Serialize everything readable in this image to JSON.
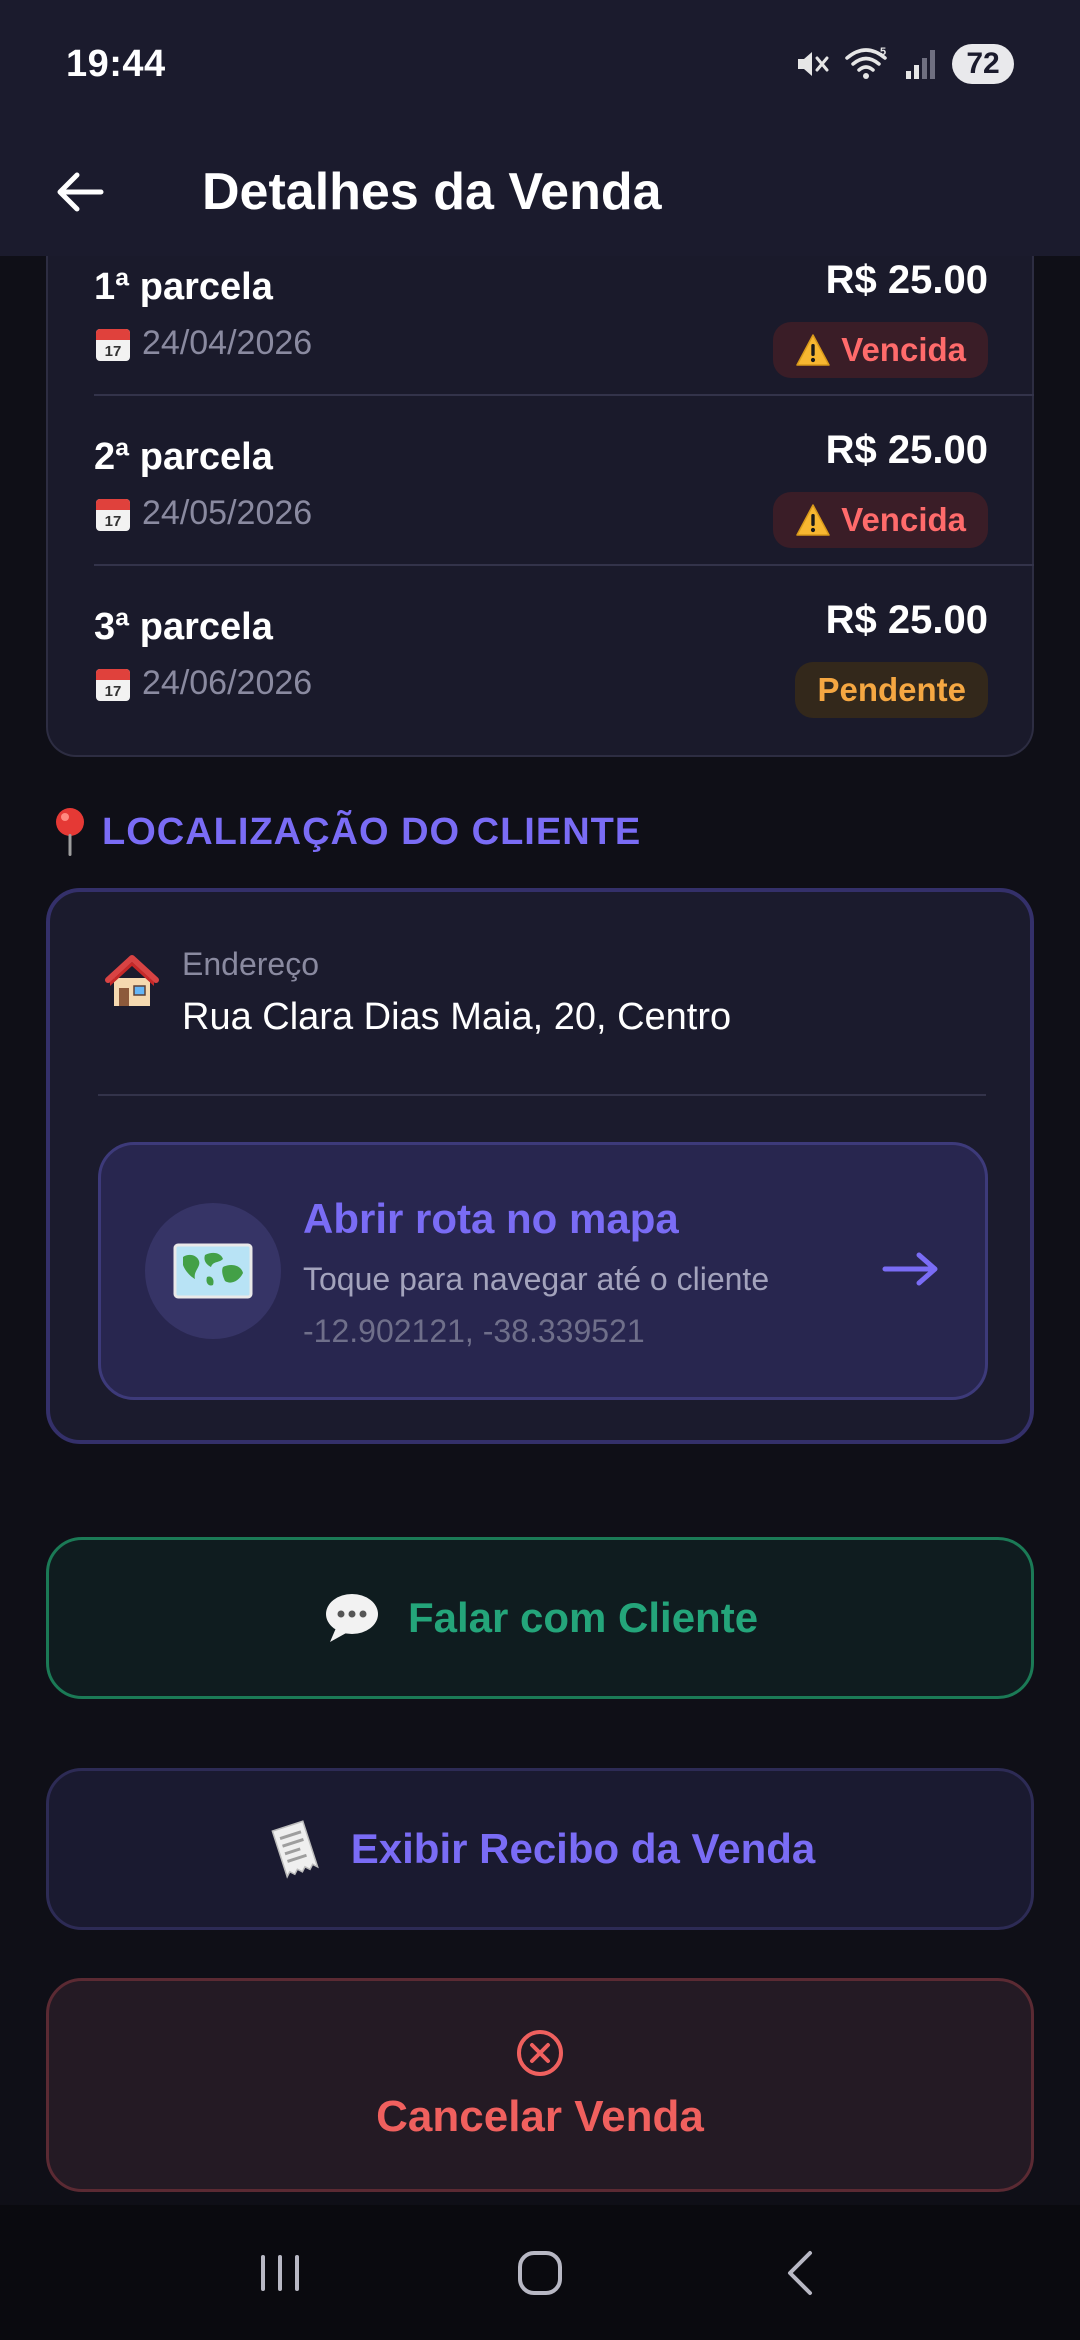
{
  "status_bar": {
    "time": "19:44",
    "battery": "72",
    "icons": [
      "mute-icon",
      "wifi-icon",
      "signal-icon",
      "battery-icon"
    ]
  },
  "header": {
    "title": "Detalhes da Venda",
    "back_icon": "arrow-left-icon"
  },
  "installments": [
    {
      "label": "1ª parcela",
      "date": "24/04/2026",
      "amount": "R$ 25.00",
      "status": "Vencida",
      "status_type": "overdue"
    },
    {
      "label": "2ª parcela",
      "date": "24/05/2026",
      "amount": "R$ 25.00",
      "status": "Vencida",
      "status_type": "overdue"
    },
    {
      "label": "3ª parcela",
      "date": "24/06/2026",
      "amount": "R$ 25.00",
      "status": "Pendente",
      "status_type": "pending"
    }
  ],
  "location": {
    "section_title": "LOCALIZAÇÃO DO CLIENTE",
    "address_label": "Endereço",
    "address_value": "Rua  Clara Dias Maia, 20, Centro",
    "route_title": "Abrir rota no mapa",
    "route_subtitle": "Toque para navegar até o cliente",
    "route_coords": "-12.902121, -38.339521"
  },
  "actions": {
    "chat_label": "Falar com Cliente",
    "receipt_label": "Exibir Recibo da Venda",
    "cancel_label": "Cancelar Venda"
  },
  "colors": {
    "background": "#0f0f17",
    "accent": "#7a6cf5",
    "overdue": "#ff6b6b",
    "pending": "#f5a742",
    "chat_green": "#24a57a",
    "cancel_red": "#f0605e"
  }
}
